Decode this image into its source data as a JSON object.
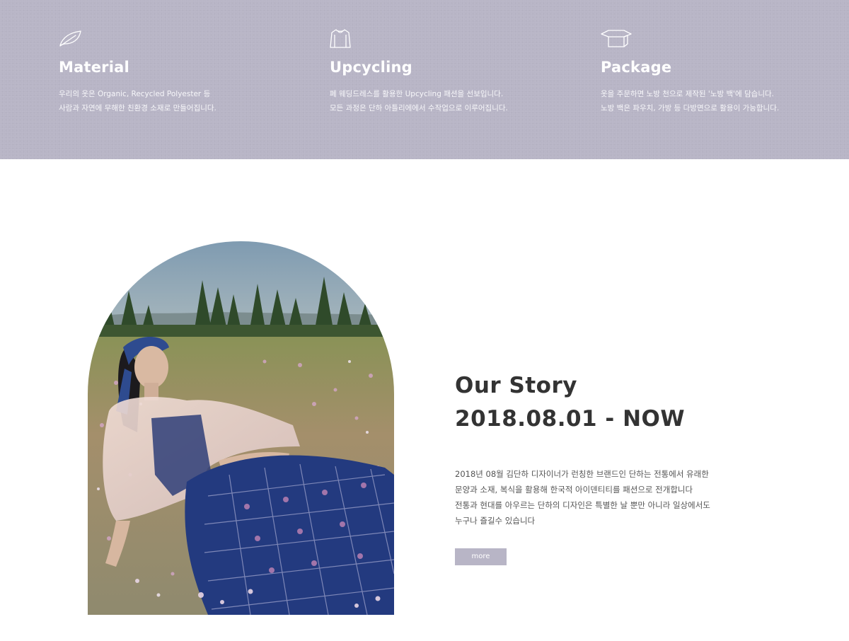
{
  "features": [
    {
      "icon": "leaf-icon",
      "title": "Material",
      "lines": [
        "우리의 옷은 Organic, Recycled Polyester 등",
        "사람과 자연에 무해한 친환경 소재로 만들어집니다."
      ]
    },
    {
      "icon": "shirt-icon",
      "title": "Upcycling",
      "lines": [
        "폐 웨딩드레스를 활용한 Upcycling 패션을 선보입니다.",
        "모든 과정은 단하 아틀리에에서 수작업으로 이루어집니다."
      ]
    },
    {
      "icon": "box-icon",
      "title": "Package",
      "lines": [
        "옷을 주문하면 노방 천으로 제작된 '노방 백'에 담습니다.",
        "노방 백은 파우치, 가방 등 다방면으로 활용이 가능합니다."
      ]
    }
  ],
  "story": {
    "title_line1": "Our Story",
    "title_line2": "2018.08.01 - NOW",
    "description": [
      "2018년 08월 김단하 디자이너가 런칭한 브랜드인 단하는 전통에서 유래한",
      "문양과 소재, 복식을 활용해 한국적 아이덴티티를 패션으로 전개합니다",
      "전통과 현대를 아우르는 단하의 디자인은 특별한 날 뿐만 아니라 일상에서도",
      "누구나 즐길수 있습니다"
    ],
    "more_label": "more"
  },
  "colors": {
    "band": "#b8b5c6",
    "button": "#b8b5c6",
    "heading": "#333333",
    "body_text": "#555555"
  }
}
